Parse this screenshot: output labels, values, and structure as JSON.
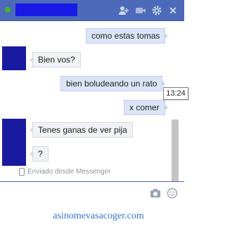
{
  "header": {
    "add_people_icon": "add-people-icon",
    "video_icon": "video-camera-icon",
    "settings_icon": "gear-icon",
    "close_icon": "close-icon",
    "close_label": "✕"
  },
  "messages": [
    {
      "side": "out",
      "text": "como estas tomas"
    },
    {
      "side": "in",
      "text": "Bien vos?"
    },
    {
      "side": "out",
      "text": "bien boludeando un rato"
    },
    {
      "side": "out",
      "text": "x comer"
    },
    {
      "side": "in",
      "text": "Tenes ganas de ver pija"
    },
    {
      "side": "in",
      "text": "?"
    }
  ],
  "tooltip": {
    "time": "13:24"
  },
  "sent_from": "Enviado desde Messenger",
  "composer": {
    "camera_icon": "camera-icon",
    "emoji_icon": "emoji-icon"
  },
  "footer": {
    "site": "asinomevasacoger.com"
  },
  "colors": {
    "header": "#4c69ba",
    "outgoing_bubble": "#dce5f7",
    "incoming_bubble": "#f1f2f5",
    "avatar_redaction": "#1a1aa0",
    "footer_text": "#3377cc"
  }
}
